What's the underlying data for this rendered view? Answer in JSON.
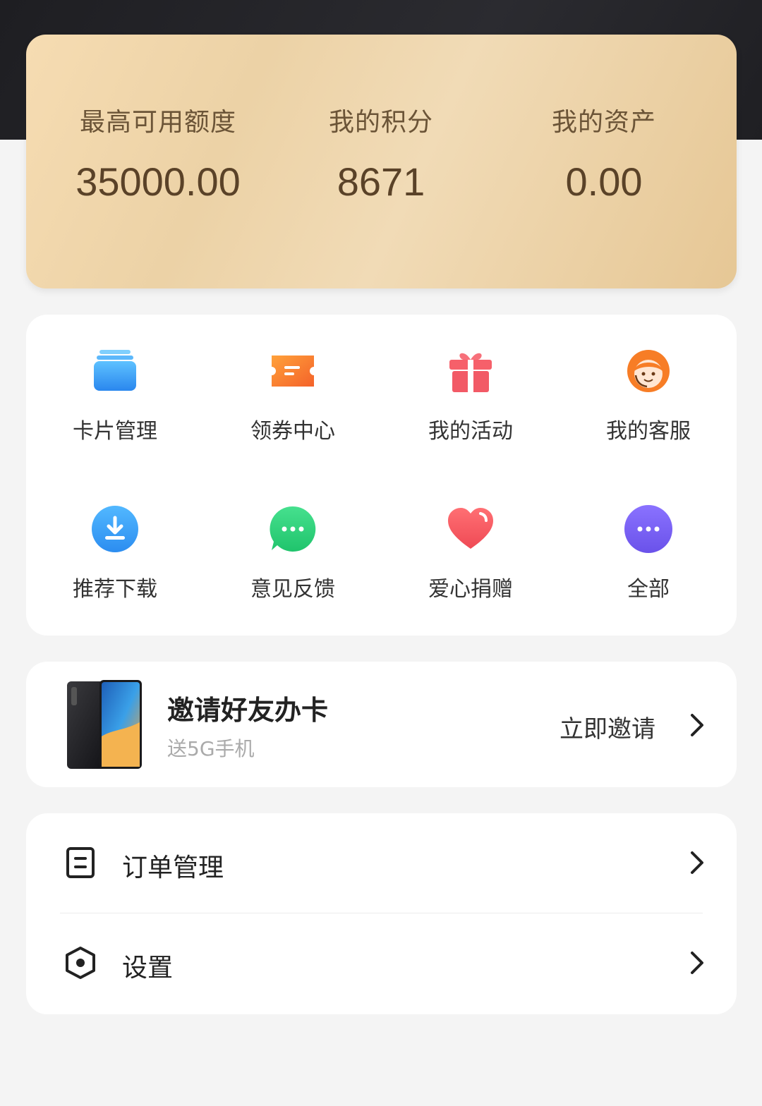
{
  "stats": [
    {
      "label": "最高可用额度",
      "value": "35000.00"
    },
    {
      "label": "我的积分",
      "value": "8671"
    },
    {
      "label": "我的资产",
      "value": "0.00"
    }
  ],
  "grid": [
    {
      "label": "卡片管理",
      "icon": "cards-icon"
    },
    {
      "label": "领券中心",
      "icon": "coupon-icon"
    },
    {
      "label": "我的活动",
      "icon": "gift-icon"
    },
    {
      "label": "我的客服",
      "icon": "customer-service-icon"
    },
    {
      "label": "推荐下载",
      "icon": "download-icon"
    },
    {
      "label": "意见反馈",
      "icon": "feedback-icon"
    },
    {
      "label": "爱心捐赠",
      "icon": "heart-icon"
    },
    {
      "label": "全部",
      "icon": "more-icon"
    }
  ],
  "invite": {
    "title": "邀请好友办卡",
    "subtitle": "送5G手机",
    "action": "立即邀请"
  },
  "menu": [
    {
      "label": "订单管理",
      "icon": "order-icon"
    },
    {
      "label": "设置",
      "icon": "settings-icon"
    }
  ],
  "colors": {
    "gold_text": "#5a4228",
    "blue": "#3b9cf2",
    "orange": "#f6762c",
    "red": "#f2575c",
    "green": "#2fd27c",
    "purple": "#7a62f2"
  }
}
